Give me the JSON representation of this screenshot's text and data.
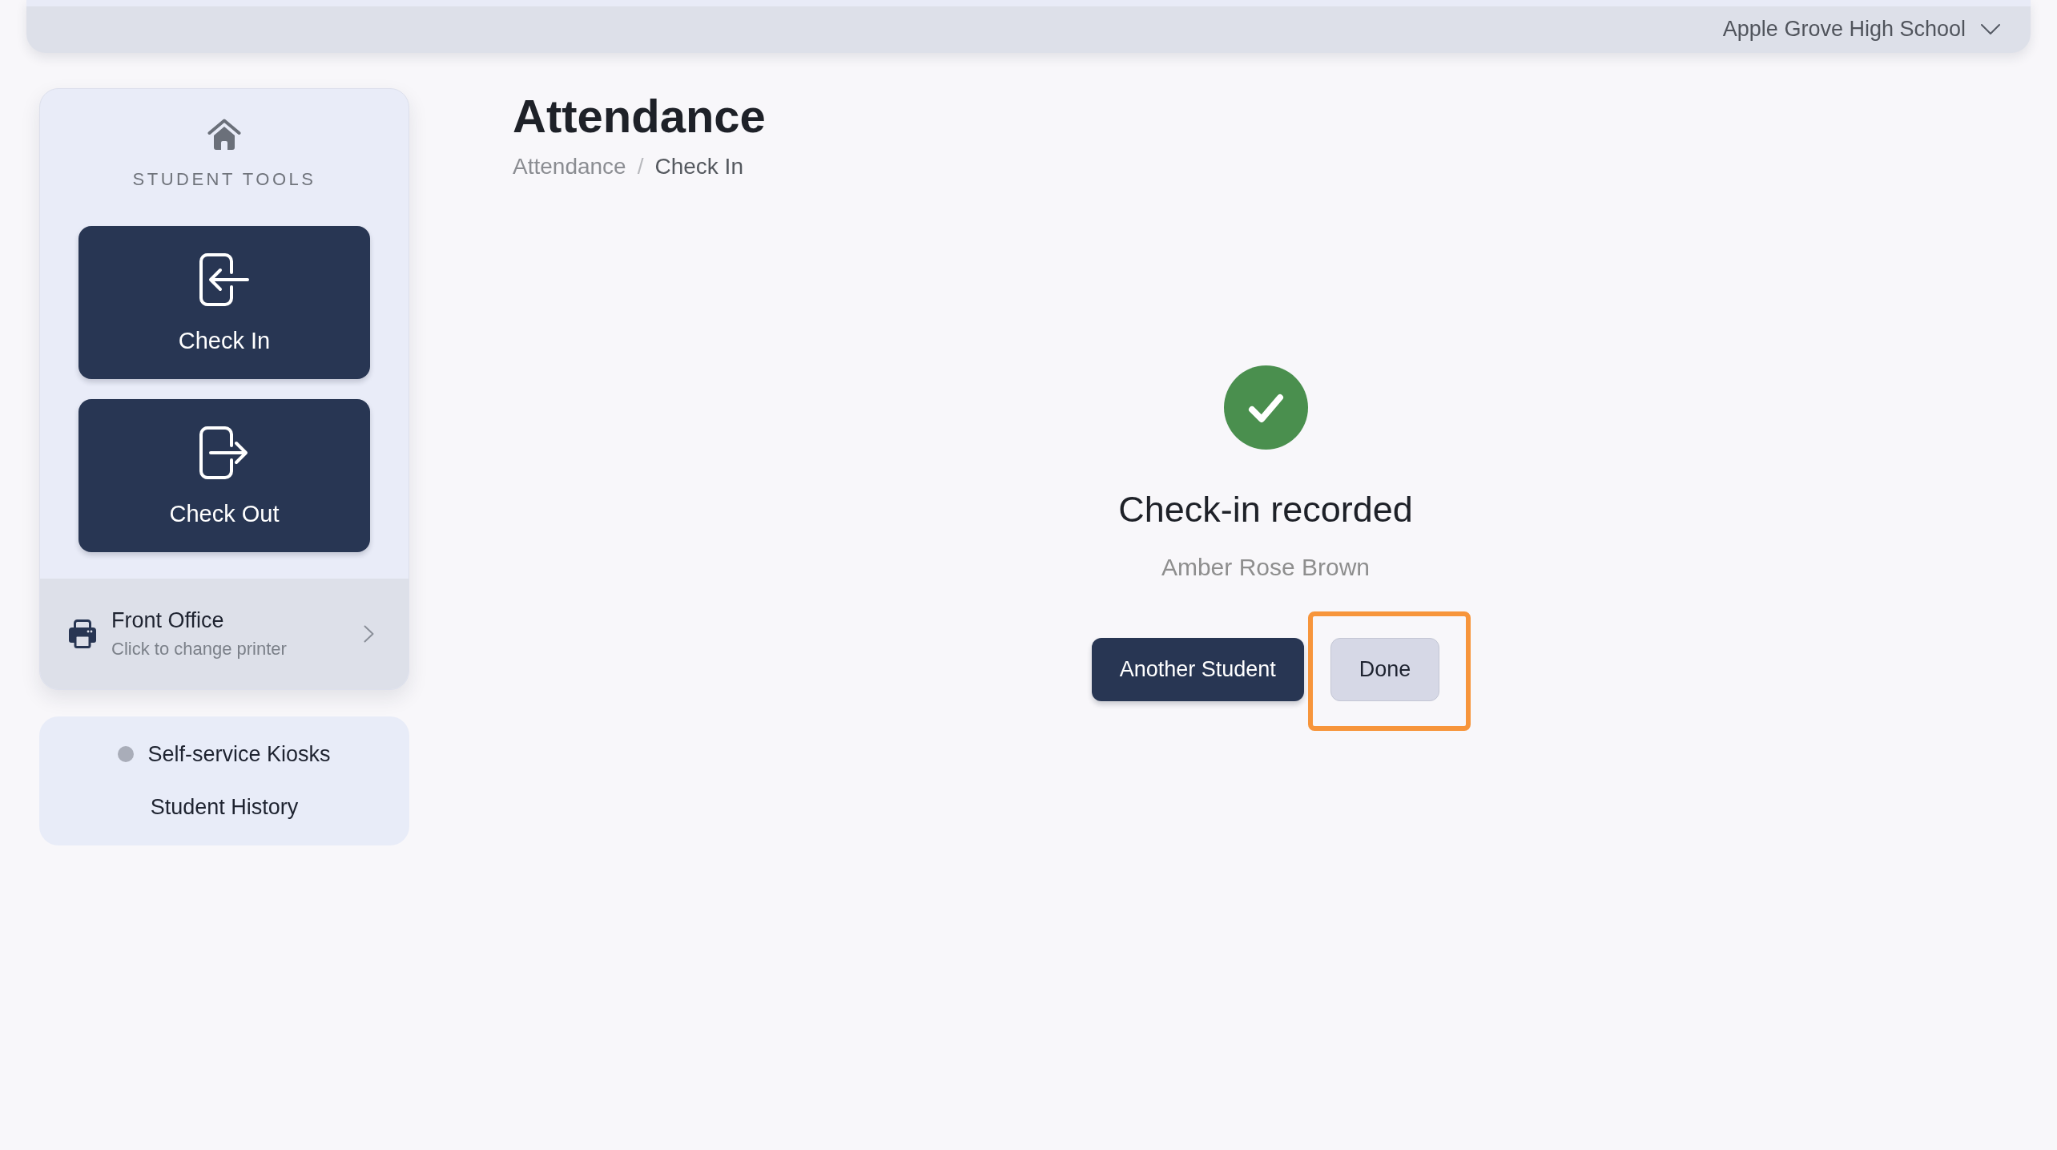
{
  "top_bar": {
    "school_selector": "Apple Grove High School"
  },
  "sidebar": {
    "section_label": "STUDENT TOOLS",
    "tools": [
      {
        "label": "Check In",
        "kind": "check-in"
      },
      {
        "label": "Check Out",
        "kind": "check-out"
      }
    ],
    "printer": {
      "name": "Front Office",
      "hint": "Click to change printer"
    },
    "links": [
      {
        "label": "Self-service Kiosks",
        "kind": "status",
        "color": "#a9adb9"
      },
      {
        "label": "Student History",
        "kind": "plain"
      }
    ]
  },
  "page": {
    "title": "Attendance",
    "breadcrumb": {
      "separator": "/",
      "items": [
        {
          "label": "Attendance",
          "current": false
        },
        {
          "label": "Check In",
          "current": true
        }
      ]
    }
  },
  "result": {
    "message": "Check-in recorded",
    "student": "Amber Rose Brown",
    "actions": [
      {
        "label": "Another Student",
        "kind": "primary",
        "highlighted": false
      },
      {
        "label": "Done",
        "kind": "secondary",
        "highlighted": true
      }
    ]
  }
}
